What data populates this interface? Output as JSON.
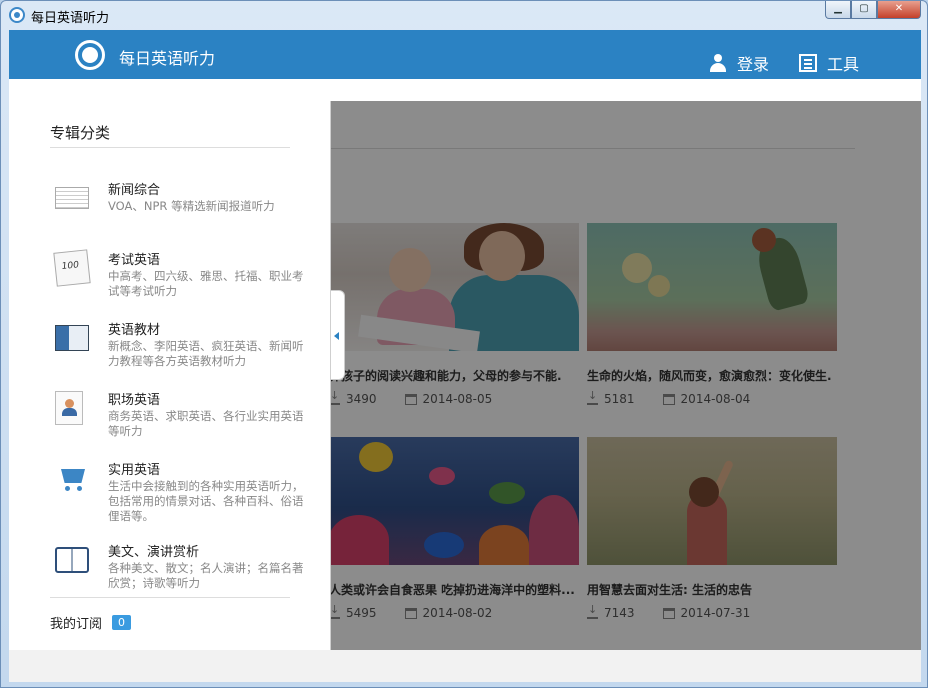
{
  "window": {
    "title": "每日英语听力"
  },
  "header": {
    "app_title": "每日英语听力",
    "login_label": "登录",
    "tools_label": "工具"
  },
  "panel": {
    "title": "专辑分类",
    "categories": [
      {
        "name": "新闻综合",
        "desc": "VOA、NPR 等精选新闻报道听力",
        "icon": "newspaper-icon"
      },
      {
        "name": "考试英语",
        "desc": "中高考、四六级、雅思、托福、职业考试等考试听力",
        "icon": "exam-paper-icon"
      },
      {
        "name": "英语教材",
        "desc": "新概念、李阳英语、疯狂英语、新闻听力教程等各方英语教材听力",
        "icon": "textbook-icon"
      },
      {
        "name": "职场英语",
        "desc": "商务英语、求职英语、各行业实用英语等听力",
        "icon": "resume-icon"
      },
      {
        "name": "实用英语",
        "desc": "生活中会接触到的各种实用英语听力，包括常用的情景对话、各种百科、俗语俚语等。",
        "icon": "cart-icon"
      },
      {
        "name": "美文、演讲赏析",
        "desc": "各种美文、散文；名人演讲；名篇名著欣赏；诗歌等听力",
        "icon": "open-book-icon"
      }
    ],
    "subscription_label": "我的订阅",
    "subscription_count": "0"
  },
  "cards": [
    {
      "title": "养孩子的阅读兴趣和能力，父母的参与不能.",
      "downloads": "3490",
      "date": "2014-08-05"
    },
    {
      "title": "生命的火焰，随风而变，愈演愈烈：变化使生.",
      "downloads": "5181",
      "date": "2014-08-04"
    },
    {
      "title": "人类或许会自食恶果 吃掉扔进海洋中的塑料...",
      "downloads": "5495",
      "date": "2014-08-02"
    },
    {
      "title": "用智慧去面对生活: 生活的忠告",
      "downloads": "7143",
      "date": "2014-07-31"
    }
  ]
}
